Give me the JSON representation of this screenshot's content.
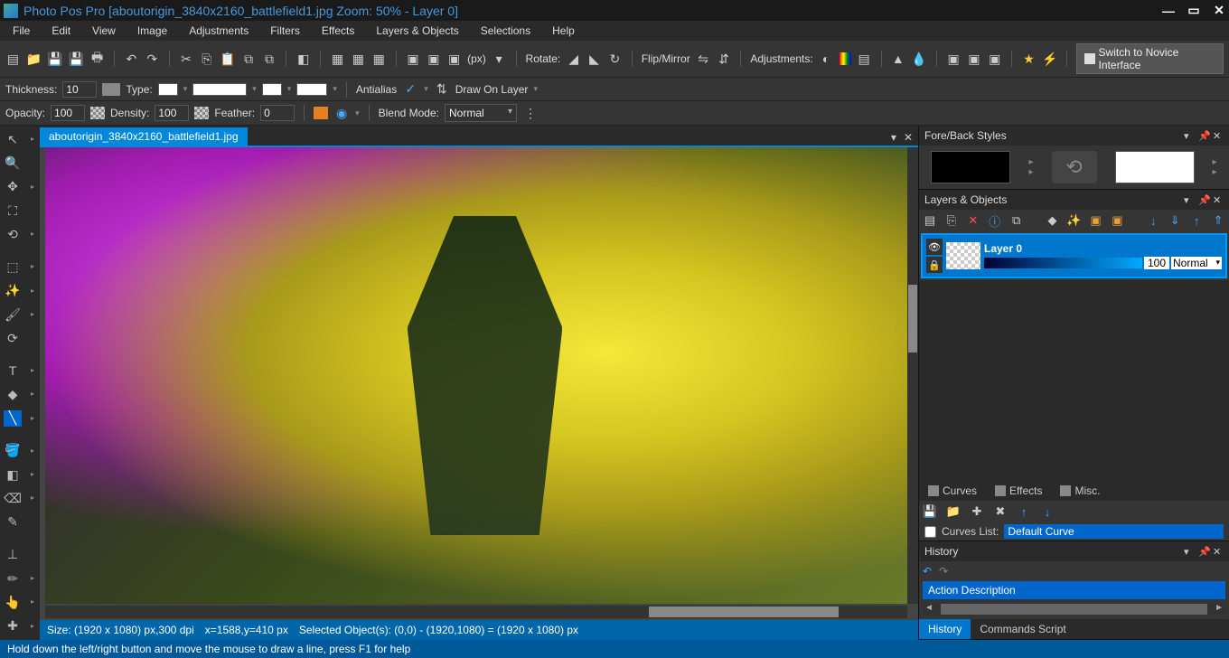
{
  "title": "Photo Pos Pro [aboutorigin_3840x2160_battlefield1.jpg Zoom: 50% - Layer 0]",
  "menu": [
    "File",
    "Edit",
    "View",
    "Image",
    "Adjustments",
    "Filters",
    "Effects",
    "Layers & Objects",
    "Selections",
    "Help"
  ],
  "toolbar1": {
    "rotate": "Rotate:",
    "flip": "Flip/Mirror",
    "adjust": "Adjustments:",
    "px": "(px)",
    "switch": "Switch to Novice Interface"
  },
  "toolbar2": {
    "thickness_lbl": "Thickness:",
    "thickness": "10",
    "type_lbl": "Type:",
    "antialias": "Antialias",
    "drawon": "Draw On Layer"
  },
  "toolbar3": {
    "opacity_lbl": "Opacity:",
    "opacity": "100",
    "density_lbl": "Density:",
    "density": "100",
    "feather_lbl": "Feather:",
    "feather": "0",
    "blend_lbl": "Blend Mode:",
    "blend": "Normal"
  },
  "doc_tab": "aboutorigin_3840x2160_battlefield1.jpg",
  "info": {
    "size": "Size: (1920 x 1080) px,300 dpi",
    "cursor": "x=1588,y=410 px",
    "sel": "Selected Object(s): (0,0) - (1920,1080) = (1920 x 1080) px"
  },
  "panels": {
    "foreback": "Fore/Back Styles",
    "layers": "Layers & Objects",
    "history": "History"
  },
  "layer": {
    "name": "Layer 0",
    "opacity": "100",
    "blend": "Normal"
  },
  "subtabs": {
    "curves": "Curves",
    "effects": "Effects",
    "misc": "Misc."
  },
  "curves_list": "Curves List:",
  "default_curve": "Default Curve",
  "history_action": "Action Description",
  "bottomtabs": {
    "history": "History",
    "commands": "Commands Script"
  },
  "status": "Hold down the left/right button and move the mouse to draw a line, press F1 for help"
}
